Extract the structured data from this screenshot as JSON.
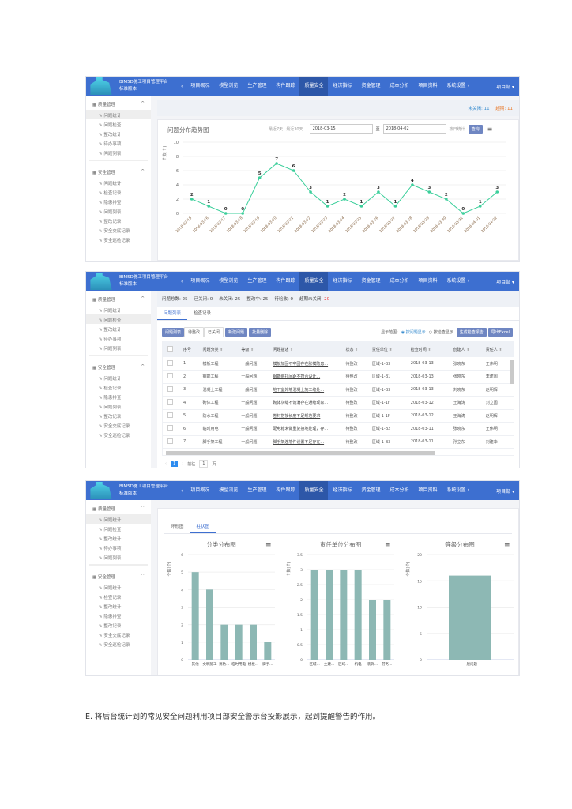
{
  "header": {
    "title": "BIM5D施工项目管理平台",
    "subtitle": "标准版本",
    "back": "‹",
    "nav": [
      "项目概况",
      "模型浏览",
      "生产管理",
      "构件跟踪",
      "质量安全",
      "经济指标",
      "资金管理",
      "成本分析",
      "项目资料",
      "系统设置 ›"
    ],
    "user": "项目部 ▾"
  },
  "sidebar": {
    "group1": "质量管理",
    "group1_items": [
      "问题统计",
      "问题检查",
      "整改统计",
      "待办事项",
      "问题列表"
    ],
    "group2": "安全管理",
    "group2_items": [
      "问题统计",
      "检查记录",
      "隐患排查",
      "问题列表",
      "整改记录",
      "安全交底记录",
      "安全巡检记录"
    ]
  },
  "sidebar3": {
    "group1_items": [
      "问题统计",
      "问题检查",
      "整改统计",
      "待办事项",
      "问题列表"
    ],
    "group2_items": [
      "问题统计",
      "检查记录",
      "整改统计",
      "隐患排查",
      "整改记录",
      "安全交底记录",
      "安全巡检记录"
    ]
  },
  "shot1": {
    "unclosed_label": "未关闭:",
    "unclosed": "11",
    "overdue_label": "超期:",
    "overdue": "11",
    "chart_title": "问题分布趋势图",
    "last7": "最近7天",
    "last30": "最近30天",
    "date_from": "2018-03-15",
    "to": "至",
    "date_to": "2018-04-02",
    "by_day": "按日统计",
    "query": "查询"
  },
  "shot2": {
    "stats": [
      {
        "label": "问题总数:",
        "value": "25"
      },
      {
        "label": "已关闭:",
        "value": "0"
      },
      {
        "label": "未关闭:",
        "value": "25"
      },
      {
        "label": "整改中:",
        "value": "25"
      },
      {
        "label": "待验收:",
        "value": "0"
      },
      {
        "label": "超期未关闭:",
        "value": "20"
      }
    ],
    "tabs": [
      "问题列表",
      "检查记录"
    ],
    "toolbar": [
      "问题列表",
      "待整改",
      "已关闭",
      "新建问题",
      "批量删除"
    ],
    "radio_label": "显示范围:",
    "radio1": "按问题显示",
    "radio2": "按检查显示",
    "export1": "生成检查报告",
    "export2": "导出Excel",
    "columns": [
      "序号",
      "问题分类",
      "等级",
      "问题描述",
      "状态",
      "责任单位",
      "检查时间",
      "创建人",
      "责任人"
    ],
    "rows": [
      [
        "1",
        "模板工程",
        "一般问题",
        "模板加固不牢固存在胀模隐患...",
        "待整改",
        "区域-1-B3",
        "2018-03-13",
        "张晓东",
        "王伟明"
      ],
      [
        "2",
        "钢筋工程",
        "一般问题",
        "钢筋绑扎间距不符合设计...",
        "待整改",
        "区域-1-B1",
        "2018-03-13",
        "张晓东",
        "李建国"
      ],
      [
        "3",
        "混凝土工程",
        "一般问题",
        "地下室外墙混凝土施工缝处...",
        "待整改",
        "区域-1-B3",
        "2018-03-13",
        "刘晓东",
        "赵明辉"
      ],
      [
        "4",
        "砌体工程",
        "一般问题",
        "砌体灰缝不饱满存在通缝现象...",
        "待整改",
        "区域-1-1F",
        "2018-03-12",
        "王海涛",
        "刘立国"
      ],
      [
        "5",
        "防水工程",
        "一般问题",
        "卷材搭接长度不足规范要求",
        "待整改",
        "区域-1-1F",
        "2018-03-12",
        "王海涛",
        "赵明辉"
      ],
      [
        "6",
        "临时用电",
        "一般问题",
        "配电箱未做重复接地处理，存...",
        "待整改",
        "区域-1-B2",
        "2018-03-11",
        "张晓东",
        "王伟明"
      ],
      [
        "7",
        "脚手架工程",
        "一般问题",
        "脚手架连墙件设置不足存在...",
        "待整改",
        "区域-1-B3",
        "2018-03-11",
        "孙立东",
        "刘建华"
      ]
    ],
    "page": "1",
    "goto": "前往",
    "goto_val": "1",
    "page_unit": "页"
  },
  "shot3": {
    "tabs": [
      "环形图",
      "柱状图"
    ]
  },
  "caption": "E. 将后台统计到的常见安全问题利用项目部安全警示台投影展示，起到提醒警告的作用。",
  "chart_data": [
    {
      "type": "line",
      "title": "问题分布趋势图",
      "ylabel": "个数(个)",
      "ylim": [
        0,
        10
      ],
      "yticks": [
        0,
        2,
        4,
        6,
        8,
        10
      ],
      "color": "#3ccf9b",
      "x": [
        "2018-03-15",
        "2018-03-16",
        "2018-03-17",
        "2018-03-18",
        "2018-03-19",
        "2018-03-20",
        "2018-03-21",
        "2018-03-22",
        "2018-03-23",
        "2018-03-24",
        "2018-03-25",
        "2018-03-26",
        "2018-03-27",
        "2018-03-28",
        "2018-03-29",
        "2018-03-30",
        "2018-03-31",
        "2018-04-01",
        "2018-04-02"
      ],
      "values": [
        2,
        1,
        0,
        0,
        5,
        7,
        6,
        3,
        1,
        2,
        1,
        3,
        1,
        4,
        3,
        2,
        0,
        1,
        3
      ]
    },
    {
      "type": "bar",
      "title": "分类分布图",
      "ylabel": "个数(个)",
      "ylim": [
        0,
        6
      ],
      "yticks": [
        0,
        1,
        2,
        3,
        4,
        5,
        6
      ],
      "color": "#8db8b4",
      "categories": [
        "其他",
        "文明施工",
        "消防...",
        "临时用电",
        "模板...",
        "脚手..."
      ],
      "values": [
        5,
        4,
        2,
        2,
        2,
        1
      ]
    },
    {
      "type": "bar",
      "title": "责任单位分布图",
      "ylabel": "个数(个)",
      "ylim": [
        0,
        3.5
      ],
      "yticks": [
        0,
        0.5,
        1,
        1.5,
        2,
        2.5,
        3,
        3.5
      ],
      "color": "#8db8b4",
      "categories": [
        "区域...",
        "土建...",
        "区域...",
        "机电",
        "装饰...",
        "劳务..."
      ],
      "values": [
        3,
        3,
        3,
        3,
        2,
        2
      ]
    },
    {
      "type": "bar",
      "title": "等级分布图",
      "ylabel": "个数(个)",
      "ylim": [
        0,
        20
      ],
      "yticks": [
        0,
        5,
        10,
        15,
        20
      ],
      "color": "#8db8b4",
      "categories": [
        "一般问题"
      ],
      "values": [
        16
      ]
    }
  ]
}
